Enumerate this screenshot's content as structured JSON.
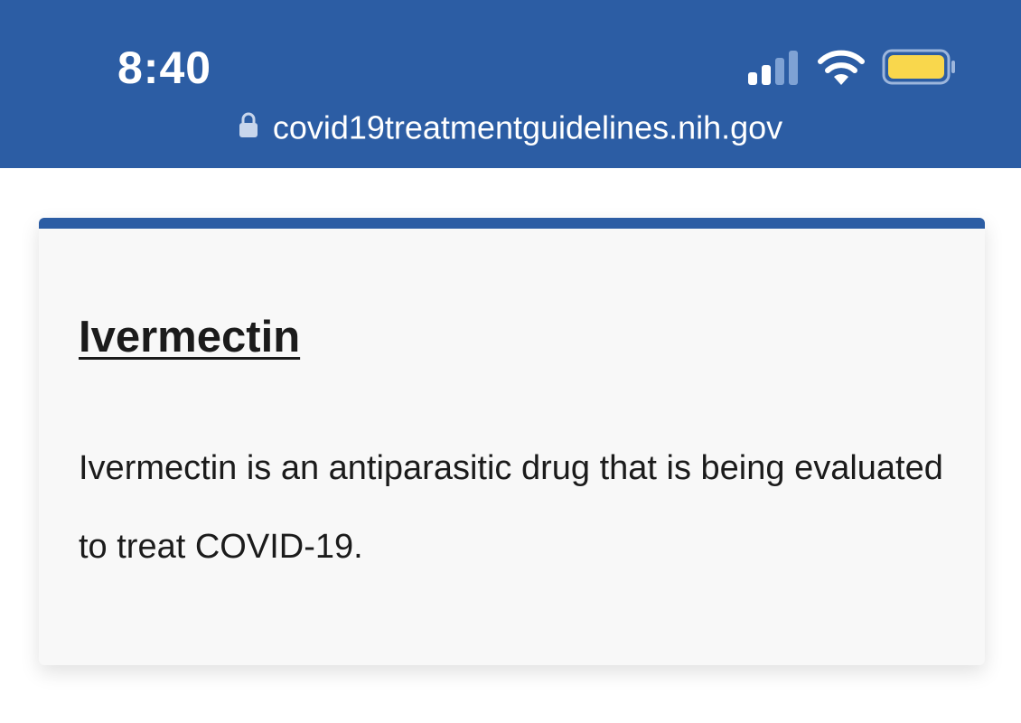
{
  "status_bar": {
    "time": "8:40",
    "background_color": "#2c5da4",
    "icons": [
      "signal-icon",
      "wifi-icon",
      "battery-icon"
    ],
    "battery_color": "#f9d74c",
    "url": "covid19treatmentguidelines.nih.gov",
    "lock_icon": "lock-icon"
  },
  "card": {
    "accent_color": "#2c5da4",
    "title": "Ivermectin",
    "description": "Ivermectin is an antiparasitic drug that is being evaluated to treat COVID-19."
  }
}
